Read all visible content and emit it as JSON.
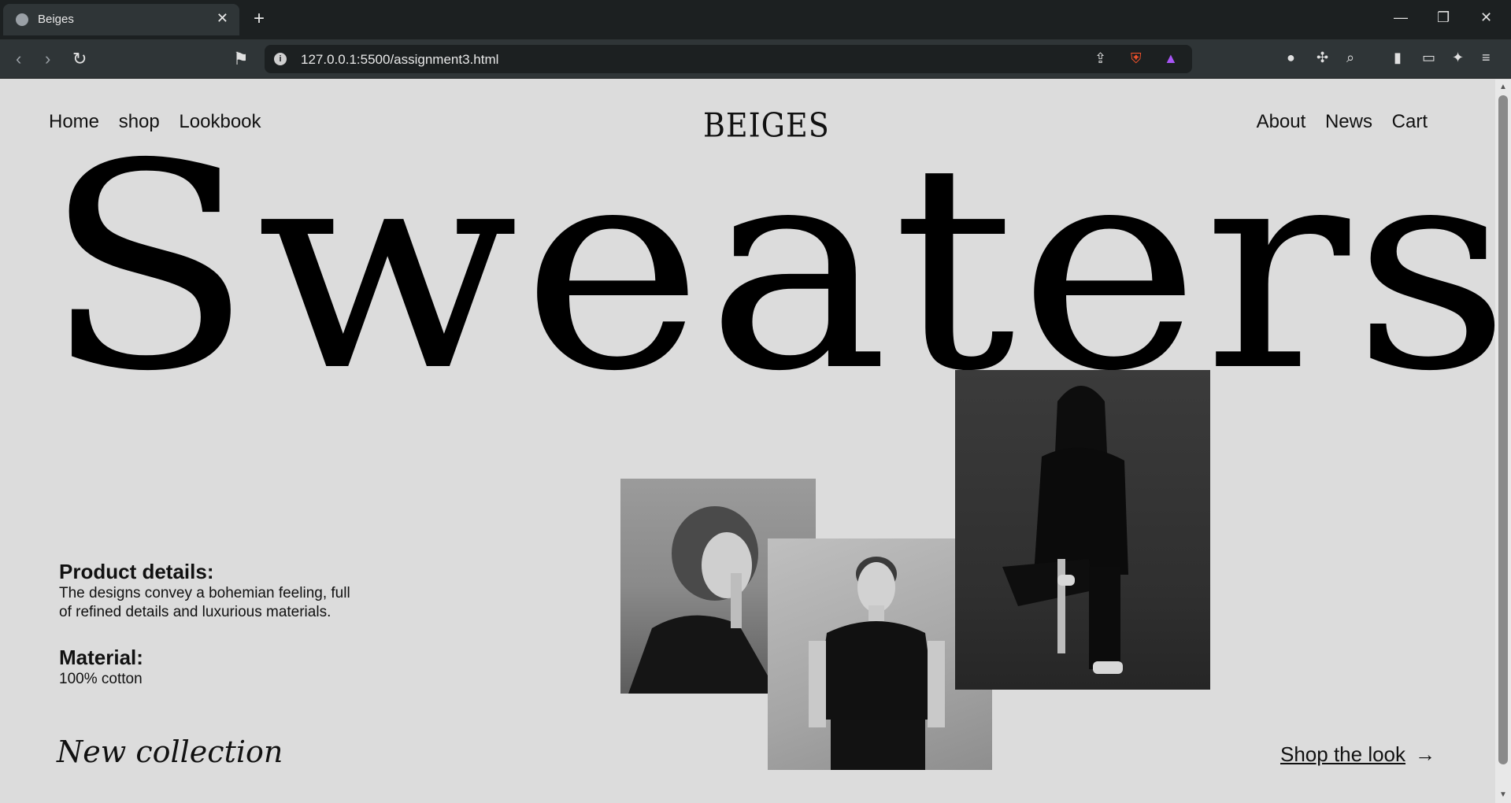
{
  "browser": {
    "tab_title": "Beiges",
    "tab_close": "✕",
    "new_tab": "+",
    "url": "127.0.0.1:5500/assignment3.html"
  },
  "nav": {
    "left": [
      "Home",
      "shop",
      "Lookbook"
    ],
    "right": [
      "About",
      "News",
      "Cart"
    ],
    "logo": "BEIGES"
  },
  "hero": {
    "title": "Sweaters"
  },
  "details": {
    "product_heading": "Product details:",
    "product_text": "The designs convey a bohemian feeling, full of refined details and luxurious materials.",
    "material_heading": "Material:",
    "material_text": "100% cotton"
  },
  "footer": {
    "new_collection": "New collection",
    "shop_the_look": "Shop the look",
    "arrow": "→"
  }
}
